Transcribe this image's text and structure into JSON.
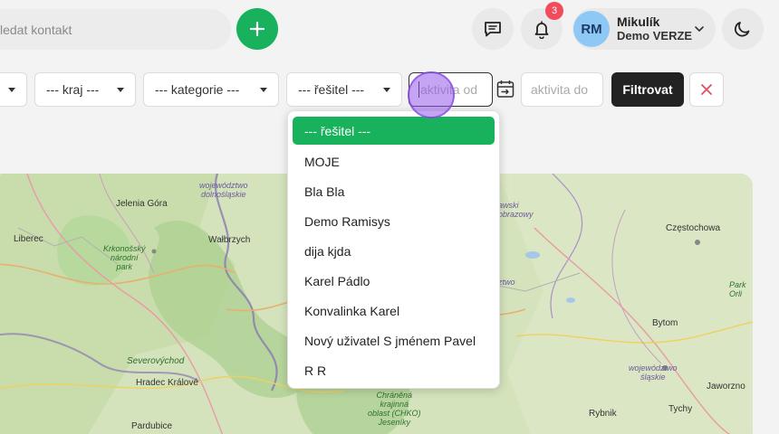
{
  "header": {
    "search_placeholder": "ledat kontakt",
    "notifications_count": "3",
    "user": {
      "initials": "RM",
      "name": "Mikulík",
      "role": "Demo VERZE"
    }
  },
  "filters": {
    "kraj": "--- kraj ---",
    "kategorie": "--- kategorie ---",
    "resitel": "--- řešitel ---",
    "aktivita_od_placeholder": "aktivita od",
    "aktivita_do_placeholder": "aktivita do",
    "filter_button": "Filtrovat"
  },
  "dropdown": {
    "items": [
      "--- řešitel ---",
      "MOJE",
      "Bla Bla",
      "Demo Ramisys",
      "dija kjda",
      "Karel Pádlo",
      "Konvalinka Karel",
      "Nový uživatel S jménem Pavel",
      "R R"
    ]
  },
  "map": {
    "labels": {
      "jelenia_gora": "Jelenia Góra",
      "liberec": "Liberec",
      "walbrzych": "Wałbrzych",
      "wojewodztwo_dolnoslaskie_1": "województwo",
      "wojewodztwo_dolnoslaskie_2": "dolnośląskie",
      "krkonossky_1": "Krkonošský",
      "krkonossky_2": "národní",
      "krkonossky_3": "park",
      "severovychod": "Severovýchod",
      "hradec_kralove": "Hradec Králové",
      "pardubice": "Pardubice",
      "chko_1": "Chráněná",
      "chko_2": "krajinná",
      "chko_3": "oblast (CHKO)",
      "chko_4": "Jeseníky",
      "czestochowa": "Częstochowa",
      "bytom": "Bytom",
      "wojewodztwo_slaskie_1": "województwo",
      "wojewodztwo_slaskie_2": "śląskie",
      "jaworzno": "Jaworzno",
      "rybnik": "Rybnik",
      "tychy": "Tychy",
      "opole_1": "awski",
      "opole_2": "obrazowy",
      "opole_3": "ztwo",
      "park_orli_1": "Park",
      "park_orli_2": "Orli"
    }
  },
  "colors": {
    "accent_green": "#18b15c",
    "badge_red": "#f24b5b",
    "dark_button": "#222222",
    "clear_x": "#e0505f"
  }
}
